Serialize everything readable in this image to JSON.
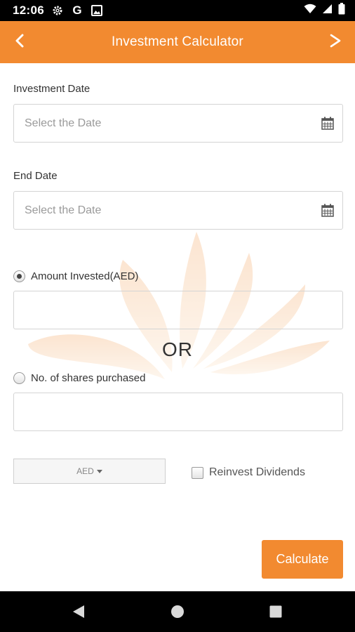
{
  "status_bar": {
    "time": "12:06",
    "left_icons": [
      "gear-icon",
      "google-icon",
      "gallery-icon"
    ],
    "right_icons": [
      "wifi-icon",
      "signal-icon",
      "battery-icon"
    ],
    "google_glyph": "G"
  },
  "app_bar": {
    "title": "Investment Calculator",
    "back_icon": "chevron-left-icon",
    "forward_icon": "chevron-right-icon"
  },
  "form": {
    "investment_date": {
      "label": "Investment Date",
      "placeholder": "Select the Date",
      "value": ""
    },
    "end_date": {
      "label": "End Date",
      "placeholder": "Select the Date",
      "value": ""
    },
    "amount_option": {
      "label": "Amount Invested(AED)",
      "selected": true,
      "value": ""
    },
    "or_text": "OR",
    "shares_option": {
      "label": "No. of shares purchased",
      "selected": false,
      "value": ""
    },
    "currency": {
      "selected": "AED"
    },
    "reinvest": {
      "label": "Reinvest Dividends",
      "checked": false
    },
    "calculate_label": "Calculate"
  },
  "colors": {
    "accent": "#f28a30",
    "watermark": "#f6a14a"
  },
  "nav_bar": {
    "icons": [
      "back-triangle-icon",
      "home-circle-icon",
      "recents-square-icon"
    ]
  }
}
